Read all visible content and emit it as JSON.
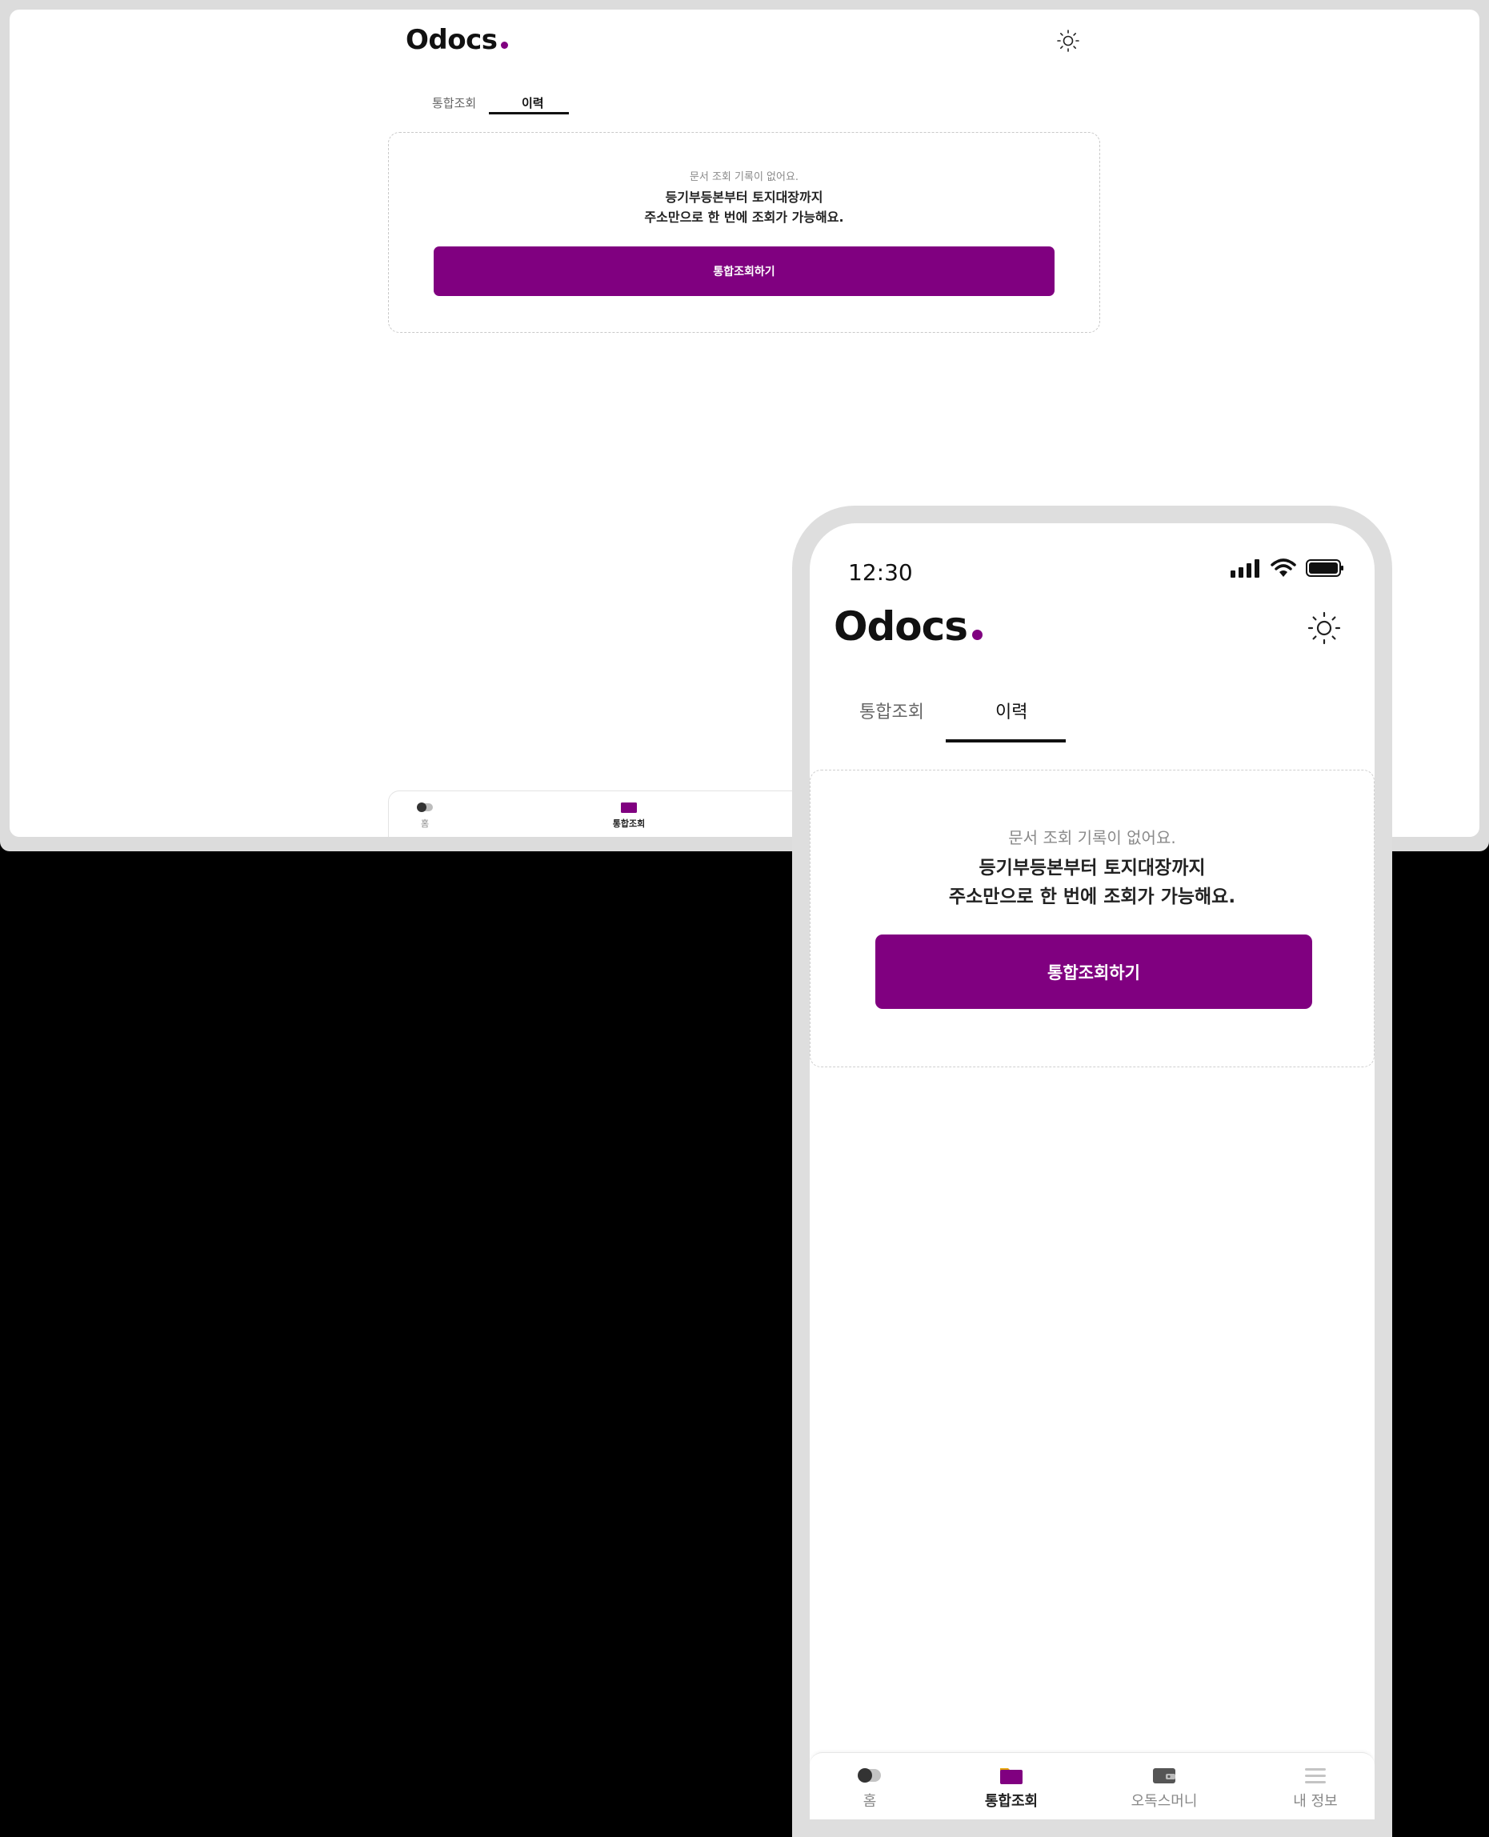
{
  "colors": {
    "brand": "#800080",
    "text": "#111111",
    "muted": "#8a8a8a"
  },
  "app": {
    "logo": "Odocs",
    "logo_dot_icon": "dot"
  },
  "tabs": [
    {
      "label": "통합조회",
      "active": false
    },
    {
      "label": "이력",
      "active": true
    }
  ],
  "empty_state": {
    "subtitle": "문서 조회 기록이 없어요.",
    "line1": "등기부등본부터 토지대장까지",
    "line2": "주소만으로 한 번에 조회가 가능해요.",
    "button": "통합조회하기"
  },
  "status_bar": {
    "time": "12:30"
  },
  "bottom_nav": [
    {
      "label": "홈",
      "icon": "toggle-icon",
      "active": false
    },
    {
      "label": "통합조회",
      "icon": "folder-icon",
      "active": true
    },
    {
      "label": "오독스머니",
      "icon": "wallet-icon",
      "active": false
    },
    {
      "label": "내 정보",
      "icon": "menu-icon",
      "active": false
    }
  ]
}
